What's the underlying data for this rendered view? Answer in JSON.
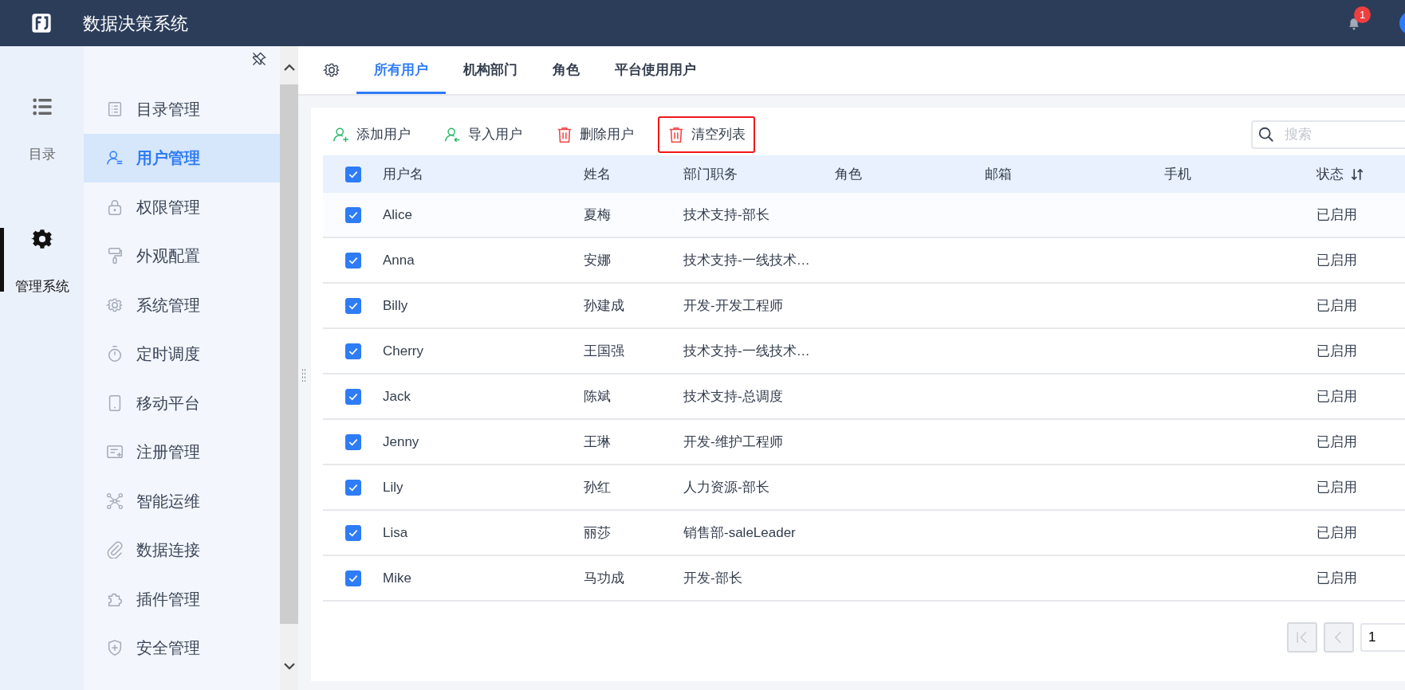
{
  "header": {
    "title": "数据决策系统",
    "notification_count": "1"
  },
  "rail": [
    {
      "label": "目录",
      "selected": false
    },
    {
      "label": "管理系统",
      "selected": true
    }
  ],
  "menu": [
    {
      "label": "目录管理",
      "selected": false
    },
    {
      "label": "用户管理",
      "selected": true
    },
    {
      "label": "权限管理",
      "selected": false
    },
    {
      "label": "外观配置",
      "selected": false
    },
    {
      "label": "系统管理",
      "selected": false
    },
    {
      "label": "定时调度",
      "selected": false
    },
    {
      "label": "移动平台",
      "selected": false
    },
    {
      "label": "注册管理",
      "selected": false
    },
    {
      "label": "智能运维",
      "selected": false
    },
    {
      "label": "数据连接",
      "selected": false
    },
    {
      "label": "插件管理",
      "selected": false
    },
    {
      "label": "安全管理",
      "selected": false
    }
  ],
  "tabs": [
    {
      "label": "所有用户",
      "selected": true
    },
    {
      "label": "机构部门",
      "selected": false
    },
    {
      "label": "角色",
      "selected": false
    },
    {
      "label": "平台使用用户",
      "selected": false
    }
  ],
  "toolbar": [
    {
      "label": "添加用户",
      "kind": "add",
      "highlighted": false
    },
    {
      "label": "导入用户",
      "kind": "import",
      "highlighted": false
    },
    {
      "label": "删除用户",
      "kind": "remove",
      "highlighted": false
    },
    {
      "label": "清空列表",
      "kind": "remove",
      "highlighted": true
    }
  ],
  "search": {
    "placeholder": "搜索"
  },
  "table": {
    "all_checked": true,
    "columns": [
      "用户名",
      "姓名",
      "部门职务",
      "角色",
      "邮箱",
      "手机",
      "状态"
    ],
    "rows": [
      {
        "checked": true,
        "cells": [
          "Alice",
          "夏梅",
          "技术支持-部长",
          "",
          "",
          "",
          "已启用"
        ]
      },
      {
        "checked": true,
        "cells": [
          "Anna",
          "安娜",
          "技术支持-一线技术…",
          "",
          "",
          "",
          "已启用"
        ]
      },
      {
        "checked": true,
        "cells": [
          "Billy",
          "孙建成",
          "开发-开发工程师",
          "",
          "",
          "",
          "已启用"
        ]
      },
      {
        "checked": true,
        "cells": [
          "Cherry",
          "王国强",
          "技术支持-一线技术…",
          "",
          "",
          "",
          "已启用"
        ]
      },
      {
        "checked": true,
        "cells": [
          "Jack",
          "陈斌",
          "技术支持-总调度",
          "",
          "",
          "",
          "已启用"
        ]
      },
      {
        "checked": true,
        "cells": [
          "Jenny",
          "王琳",
          "开发-维护工程师",
          "",
          "",
          "",
          "已启用"
        ]
      },
      {
        "checked": true,
        "cells": [
          "Lily",
          "孙红",
          "人力资源-部长",
          "",
          "",
          "",
          "已启用"
        ]
      },
      {
        "checked": true,
        "cells": [
          "Lisa",
          "丽莎",
          "销售部-saleLeader",
          "",
          "",
          "",
          "已启用"
        ]
      },
      {
        "checked": true,
        "cells": [
          "Mike",
          "马功成",
          "开发-部长",
          "",
          "",
          "",
          "已启用"
        ]
      }
    ]
  },
  "pagination": {
    "page": "1"
  }
}
